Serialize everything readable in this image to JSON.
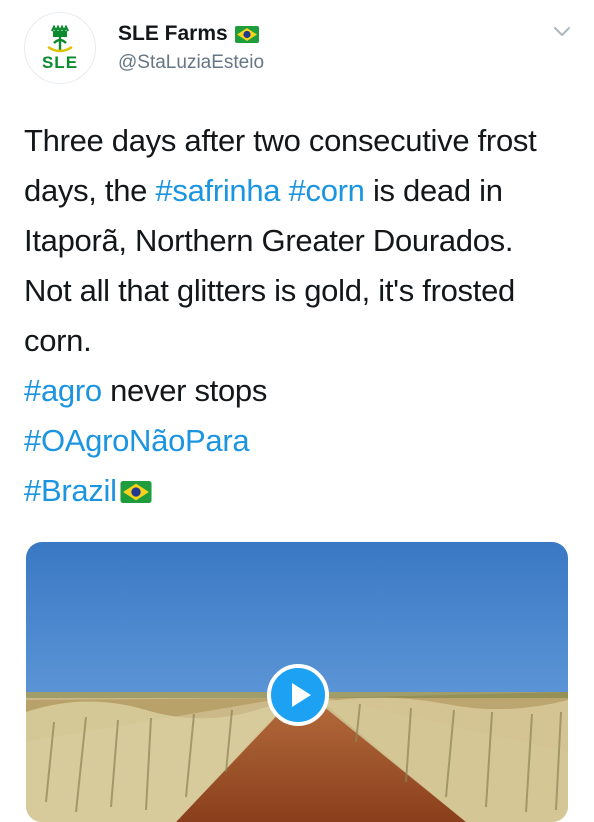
{
  "account": {
    "logo_text": "SLE",
    "display_name": "SLE Farms",
    "handle": "@StaLuziaEsteio",
    "flag_icon": "brazil-flag-icon"
  },
  "tweet": {
    "line1": "Three days after two consecutive frost",
    "line2_pre": "days, the ",
    "tag_safrinha": "#safrinha",
    "tag_corn": "#corn",
    "line2_post": " is dead in",
    "line3": "Itaporã, Northern Greater Dourados.",
    "line4": "Not all that glitters is gold, it's frosted",
    "line5": "corn.",
    "tag_agro": "#agro",
    "line6_post": " never stops",
    "tag_oagro": "#OAgroNãoPara",
    "tag_brazil": "#Brazil"
  },
  "colors": {
    "hashtag": "#1b95e0",
    "handle": "#657786",
    "logo_green": "#0b8a2e",
    "play_button": "#1da1f2"
  },
  "media": {
    "type": "video",
    "play_icon": "play-icon"
  }
}
